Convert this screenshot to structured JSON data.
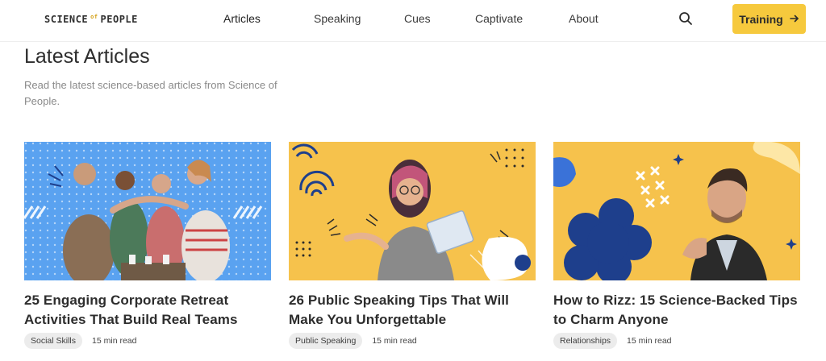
{
  "header": {
    "logo_left": "SCIENCE",
    "logo_of": "of",
    "logo_right": "PEOPLE",
    "nav": [
      {
        "label": "Articles"
      },
      {
        "label": "Speaking"
      },
      {
        "label": "Cues"
      },
      {
        "label": "Captivate"
      },
      {
        "label": "About"
      }
    ],
    "search_icon": "search-icon",
    "training_label": "Training",
    "training_icon": "arrow-right-icon"
  },
  "main": {
    "title": "Latest Articles",
    "subtitle": "Read the latest science-based articles from Science of People."
  },
  "colors": {
    "accent_yellow": "#f6c93d",
    "card1_bg": "#5aa2f0",
    "card2_bg": "#f6c24c",
    "card3_bg": "#f6c24c",
    "navy": "#1e3f8c"
  },
  "articles": [
    {
      "title": "25 Engaging Corporate Retreat Activities That Build Real Teams",
      "tag": "Social Skills",
      "read_time": "15 min read"
    },
    {
      "title": "26 Public Speaking Tips That Will Make You Unforgettable",
      "tag": "Public Speaking",
      "read_time": "15 min read"
    },
    {
      "title": "How to Rizz: 15 Science-Backed Tips to Charm Anyone",
      "tag": "Relationships",
      "read_time": "15 min read"
    }
  ]
}
